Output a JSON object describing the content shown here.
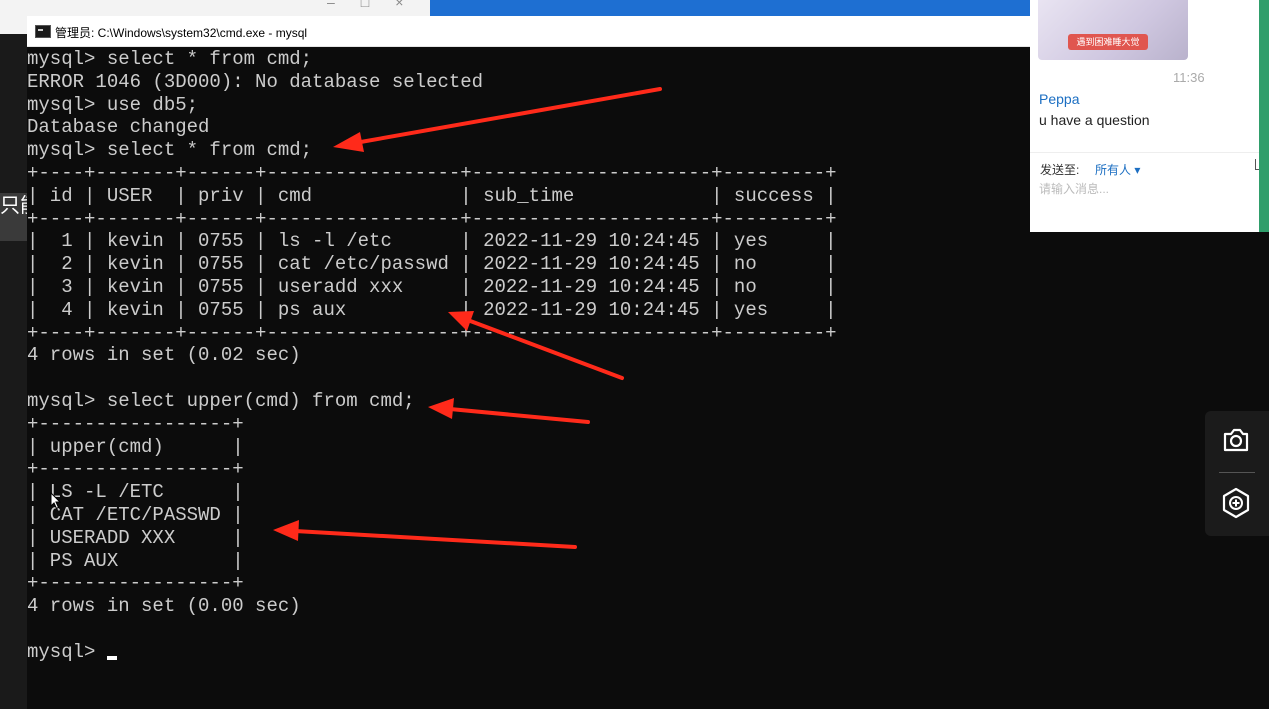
{
  "background_app": {
    "side_label": "只能"
  },
  "window": {
    "title": "管理员: C:\\Windows\\system32\\cmd.exe - mysql",
    "icon": "cmd-icon"
  },
  "console": {
    "lines": [
      "mysql> select * from cmd;",
      "ERROR 1046 (3D000): No database selected",
      "mysql> use db5;",
      "Database changed",
      "mysql> select * from cmd;",
      "+----+-------+------+-----------------+---------------------+---------+",
      "| id | USER  | priv | cmd             | sub_time            | success |",
      "+----+-------+------+-----------------+---------------------+---------+",
      "|  1 | kevin | 0755 | ls -l /etc      | 2022-11-29 10:24:45 | yes     |",
      "|  2 | kevin | 0755 | cat /etc/passwd | 2022-11-29 10:24:45 | no      |",
      "|  3 | kevin | 0755 | useradd xxx     | 2022-11-29 10:24:45 | no      |",
      "|  4 | kevin | 0755 | ps aux          | 2022-11-29 10:24:45 | yes     |",
      "+----+-------+------+-----------------+---------------------+---------+",
      "4 rows in set (0.02 sec)",
      "",
      "mysql> select upper(cmd) from cmd;",
      "+-----------------+",
      "| upper(cmd)      |",
      "+-----------------+",
      "| LS -L /ETC      |",
      "| CAT /ETC/PASSWD |",
      "| USERADD XXX     |",
      "| PS AUX          |",
      "+-----------------+",
      "4 rows in set (0.00 sec)",
      "",
      "mysql> "
    ]
  },
  "chat": {
    "image_caption": "遇到困难睡大觉",
    "time": "11:36",
    "user": "Peppa",
    "message": "u have a question",
    "send_to_label": "发送至:",
    "recipient": "所有人 ▾",
    "input_placeholder": "请输入消息..."
  },
  "toolbar": {
    "buttons": [
      "camera-icon",
      "hexagon-plus-icon"
    ]
  },
  "annotation_color": "#ff2a1a"
}
